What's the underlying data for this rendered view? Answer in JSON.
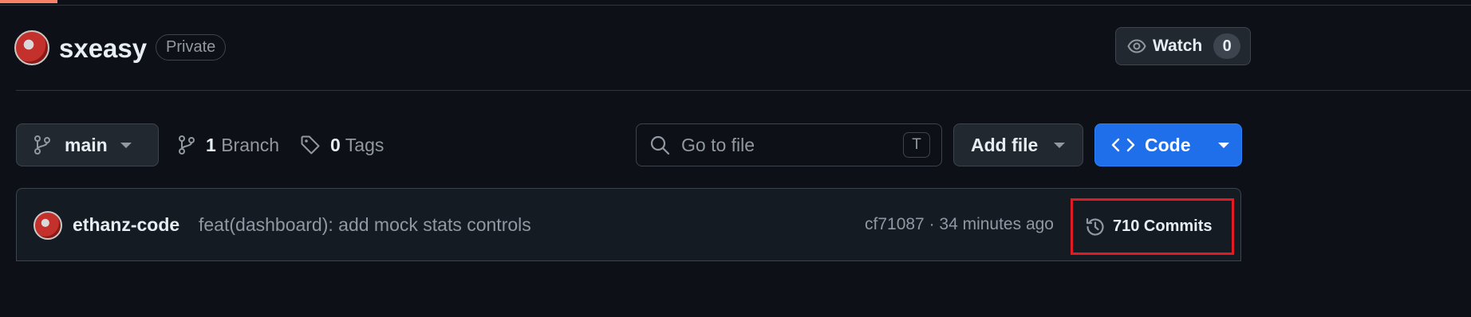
{
  "repo": {
    "name": "sxeasy",
    "visibility": "Private"
  },
  "watch": {
    "label": "Watch",
    "count": "0"
  },
  "toolbar": {
    "branch_name": "main",
    "branch_count": "1",
    "branch_label": "Branch",
    "tag_count": "0",
    "tag_label": "Tags",
    "search_placeholder": "Go to file",
    "search_shortcut": "T",
    "add_file_label": "Add file",
    "code_label": "Code"
  },
  "latest_commit": {
    "author": "ethanz-code",
    "message": "feat(dashboard): add mock stats controls",
    "meta": "cf71087 · 34 minutes ago",
    "commits_label": "710 Commits"
  },
  "icons": {
    "watch": "eye-icon",
    "branch": "git-branch-icon",
    "tag": "tag-icon",
    "search": "search-icon",
    "code": "code-icon",
    "history": "history-icon"
  },
  "colors": {
    "background": "#0d1117",
    "accent": "#1f6feb",
    "highlight_box": "#e01b24"
  }
}
